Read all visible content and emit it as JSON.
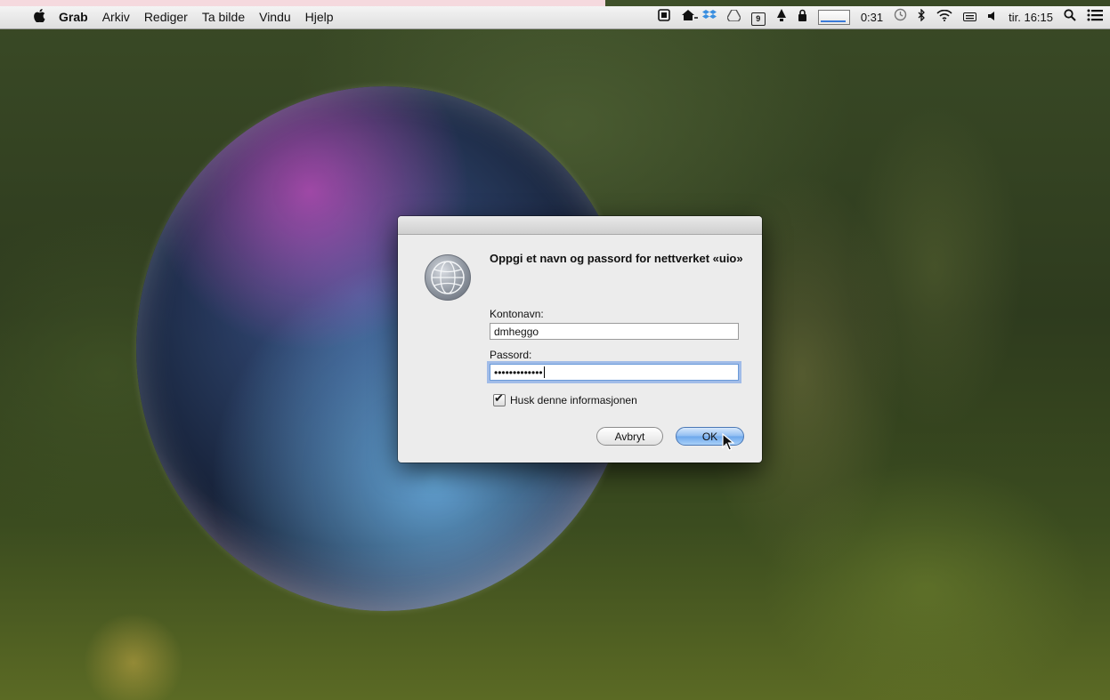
{
  "menubar": {
    "apple_icon": "",
    "app_name": "Grab",
    "menus": [
      "Arkiv",
      "Rediger",
      "Ta bilde",
      "Vindu",
      "Hjelp"
    ],
    "battery_time": "0:31",
    "calendar_day": "9",
    "clock": "tir. 16:15"
  },
  "dialog": {
    "title": "Oppgi et navn og passord for nettverket «uio»",
    "account_label": "Kontonavn:",
    "account_value": "dmheggo",
    "password_label": "Passord:",
    "password_value": "•••••••••••••",
    "remember_label": "Husk denne informasjonen",
    "remember_checked": true,
    "cancel_label": "Avbryt",
    "ok_label": "OK"
  },
  "icons": {
    "network": "network-globe-icon",
    "status": [
      "remote-desktop-icon",
      "home-sync-icon",
      "dropbox-icon",
      "google-drive-icon",
      "calendar-icon",
      "notification-icon",
      "lock-icon",
      "activity-graph-icon",
      "time-machine-icon",
      "bluetooth-icon",
      "wifi-icon",
      "keyboard-icon",
      "volume-icon",
      "spotlight-icon",
      "notification-center-icon"
    ]
  },
  "colors": {
    "accent": "#6ca7ec",
    "focus_ring": "#6a9ad8"
  }
}
